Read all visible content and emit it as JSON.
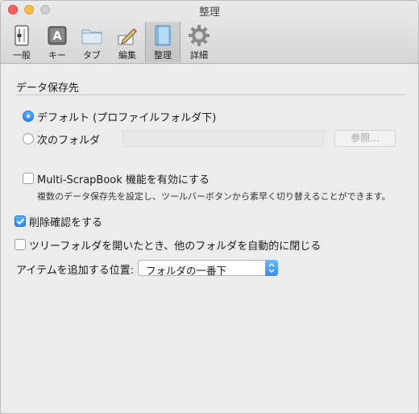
{
  "window": {
    "title": "整理"
  },
  "toolbar": {
    "items": [
      {
        "label": "一般",
        "icon": "switch-icon"
      },
      {
        "label": "キー",
        "icon": "key-icon"
      },
      {
        "label": "タブ",
        "icon": "folder-icon"
      },
      {
        "label": "編集",
        "icon": "pencil-icon"
      },
      {
        "label": "整理",
        "icon": "notebook-icon",
        "selected": true
      },
      {
        "label": "詳細",
        "icon": "gear-icon"
      }
    ]
  },
  "data_section": {
    "title": "データ保存先",
    "default_option": "デフォルト (プロファイルフォルダ下)",
    "folder_option": "次のフォルダ",
    "folder_path": "",
    "browse_button": "参照...",
    "selected": "default"
  },
  "multi": {
    "label": "Multi-ScrapBook 機能を有効にする",
    "description": "複数のデータ保存先を設定し、ツールバーボタンから素早く切り替えることができます。",
    "checked": false
  },
  "confirm_delete": {
    "label": "削除確認をする",
    "checked": true
  },
  "tree_close": {
    "label": "ツリーフォルダを開いたとき、他のフォルダを自動的に閉じる",
    "checked": false
  },
  "add_position": {
    "label": "アイテムを追加する位置:",
    "value": "フォルダの一番下"
  },
  "colors": {
    "accent": "#2a8af4",
    "window_bg": "#ececec"
  }
}
